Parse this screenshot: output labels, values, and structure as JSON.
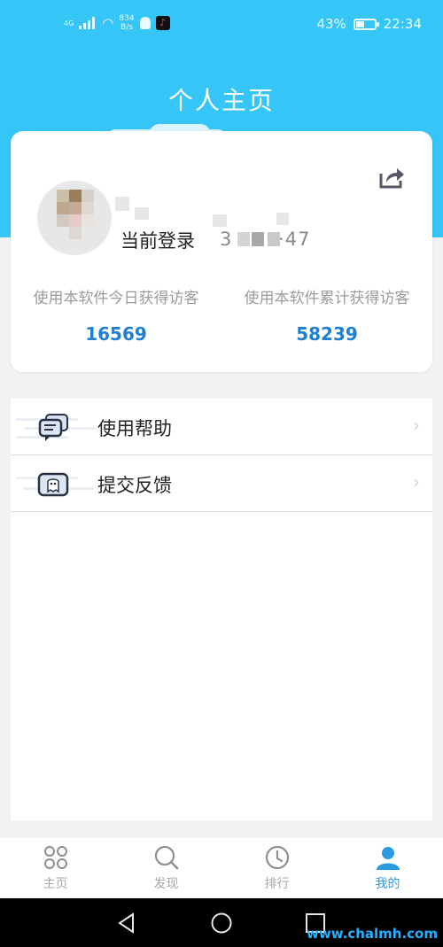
{
  "status_bar": {
    "network": "4G",
    "speed_value": "834",
    "speed_unit": "B/s",
    "battery": "43%",
    "time": "22:34"
  },
  "header": {
    "title": "个人主页"
  },
  "profile": {
    "login_label": "当前登录",
    "login_value": "3  ··47",
    "stats": [
      {
        "label": "使用本软件今日获得访客",
        "value": "16569"
      },
      {
        "label": "使用本软件累计获得访客",
        "value": "58239"
      }
    ]
  },
  "menu": {
    "items": [
      {
        "label": "使用帮助",
        "icon": "chat-bubble-icon"
      },
      {
        "label": "提交反馈",
        "icon": "feedback-ghost-icon"
      }
    ]
  },
  "bottom_nav": {
    "items": [
      {
        "label": "主页",
        "icon": "grid-circles-icon"
      },
      {
        "label": "发现",
        "icon": "search-icon"
      },
      {
        "label": "排行",
        "icon": "clock-icon"
      },
      {
        "label": "我的",
        "icon": "user-icon"
      }
    ],
    "active_index": 3
  },
  "watermark": "www.chalmh.com",
  "colors": {
    "header_blue": "#35c5f6",
    "accent_blue": "#1f7fd0",
    "active_nav": "#2a9be0"
  }
}
